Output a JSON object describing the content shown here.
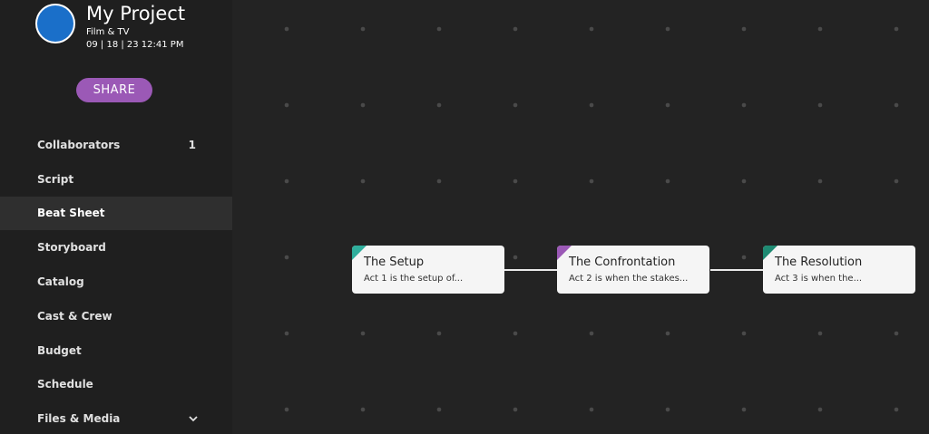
{
  "project": {
    "title": "My Project",
    "category": "Film & TV",
    "date": "09 | 18 | 23 12:41 PM",
    "avatar_color": "#1a6fc9"
  },
  "share_button": {
    "label": "SHARE",
    "color": "#9b59b6"
  },
  "sidebar": {
    "items": [
      {
        "label": "Collaborators",
        "count": "1"
      },
      {
        "label": "Script"
      },
      {
        "label": "Beat Sheet",
        "active": true
      },
      {
        "label": "Storyboard"
      },
      {
        "label": "Catalog"
      },
      {
        "label": "Cast & Crew"
      },
      {
        "label": "Budget"
      },
      {
        "label": "Schedule"
      },
      {
        "label": "Files & Media",
        "icon": "chevron-down-icon"
      }
    ]
  },
  "beats": [
    {
      "title": "The Setup",
      "description": "Act 1 is the setup of...",
      "accent": "#2fae9c"
    },
    {
      "title": "The Confrontation",
      "description": "Act 2 is when the stakes...",
      "accent": "#9b59b6"
    },
    {
      "title": "The Resolution",
      "description": "Act 3 is when the...",
      "accent": "#1e8a72"
    }
  ]
}
